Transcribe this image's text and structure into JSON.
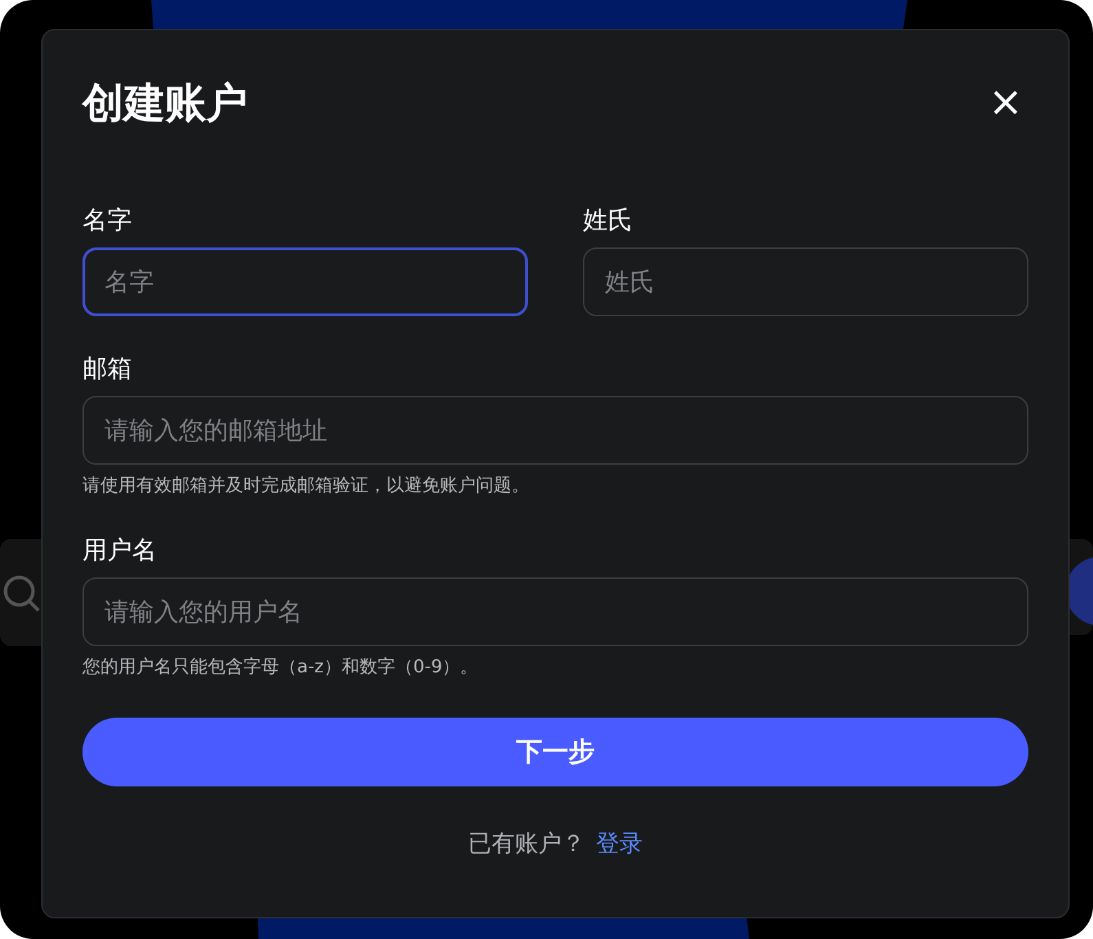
{
  "dialog": {
    "title": "创建账户",
    "close": "×"
  },
  "name_row": [
    {
      "label": "名字",
      "placeholder": "名字",
      "focused": true
    },
    {
      "label": "姓氏",
      "placeholder": "姓氏",
      "focused": false
    }
  ],
  "fields": [
    {
      "label": "邮箱",
      "placeholder": "请输入您的邮箱地址",
      "hint": "请使用有效邮箱并及时完成邮箱验证，以避免账户问题。",
      "focused": false
    },
    {
      "label": "用户名",
      "placeholder": "请输入您的用户名",
      "hint": "您的用户名只能包含字母（a-z）和数字（0-9）。",
      "focused": false
    }
  ],
  "submit": "下一步",
  "footer": {
    "text": "已有账户？",
    "link": "登录"
  }
}
